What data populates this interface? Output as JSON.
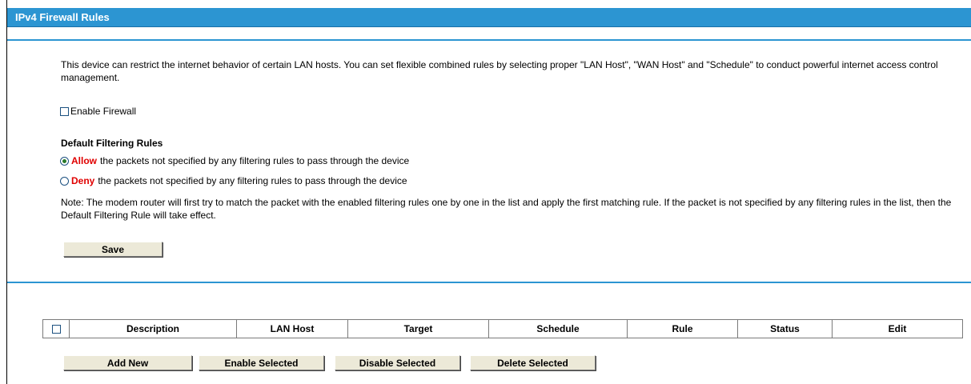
{
  "header": {
    "title": "IPv4 Firewall Rules"
  },
  "intro": {
    "description": "This device can restrict the internet behavior of certain LAN hosts. You can set flexible combined rules by selecting proper \"LAN Host\", \"WAN Host\" and \"Schedule\" to conduct powerful internet access control management."
  },
  "firewall": {
    "enable_label": "Enable Firewall",
    "enabled": false
  },
  "default_rules": {
    "heading": "Default Filtering Rules",
    "allow_keyword": "Allow",
    "allow_text": "the packets not specified by any filtering rules to pass through the device",
    "deny_keyword": "Deny",
    "deny_text": "the packets not specified by any filtering rules to pass through the device",
    "selected": "Allow",
    "note": "Note: The modem router will first try to match the packet with the enabled filtering rules one by one in the list and apply the first matching rule. If the packet is not specified by any filtering rules in the list, then the Default Filtering Rule will take effect."
  },
  "buttons": {
    "save": "Save",
    "add_new": "Add New",
    "enable_selected": "Enable Selected",
    "disable_selected": "Disable Selected",
    "delete_selected": "Delete Selected"
  },
  "table": {
    "columns": [
      "Description",
      "LAN Host",
      "Target",
      "Schedule",
      "Rule",
      "Status",
      "Edit"
    ],
    "rows": []
  },
  "colors": {
    "accent": "#2c95d2",
    "keyword": "#e00000"
  }
}
